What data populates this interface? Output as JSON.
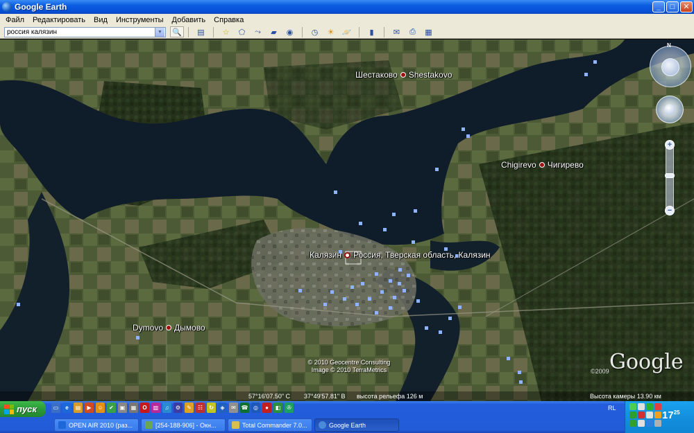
{
  "window": {
    "title": "Google Earth",
    "minimize": "_",
    "maximize": "□",
    "close": "✕"
  },
  "menu": [
    "Файл",
    "Редактировать",
    "Вид",
    "Инструменты",
    "Добавить",
    "Справка"
  ],
  "search": {
    "value": "россия калязин"
  },
  "map": {
    "places": {
      "shestakovo": "Шестаково ● Shestakovo",
      "shestakovo_ru": "Шестаково",
      "shestakovo_en": "Shestakovo",
      "chigirevo_en": "Chigirevo",
      "chigirevo_ru": "Чигирево",
      "kalyazin": "Калязин",
      "kalyazin_full": "Россия, Тверская область, Калязин",
      "dymovo_en": "Dymovo",
      "dymovo_ru": "Дымово"
    },
    "copyright_1": "© 2010 Geocentre Consulting",
    "copyright_2": "Image © 2010 TerraMetrics",
    "google": "Google",
    "year": "©2009",
    "nav_north": "N",
    "zoom_in": "+",
    "zoom_out": "−"
  },
  "status": {
    "lat": "57°16'07.50\" С",
    "lon": "37°49'57.81\" В",
    "elevation": "высота рельефа  126 м",
    "eye": "Высота камеры   13.90 км"
  },
  "taskbar": {
    "start": "пуск",
    "tasks": [
      "OPEN AIR 2010 (раз...",
      "[254-188-906] - Окн...",
      "Total Commander 7.0...",
      "Google Earth"
    ],
    "lang": "RL",
    "clock": "17",
    "clock_min": "25"
  }
}
